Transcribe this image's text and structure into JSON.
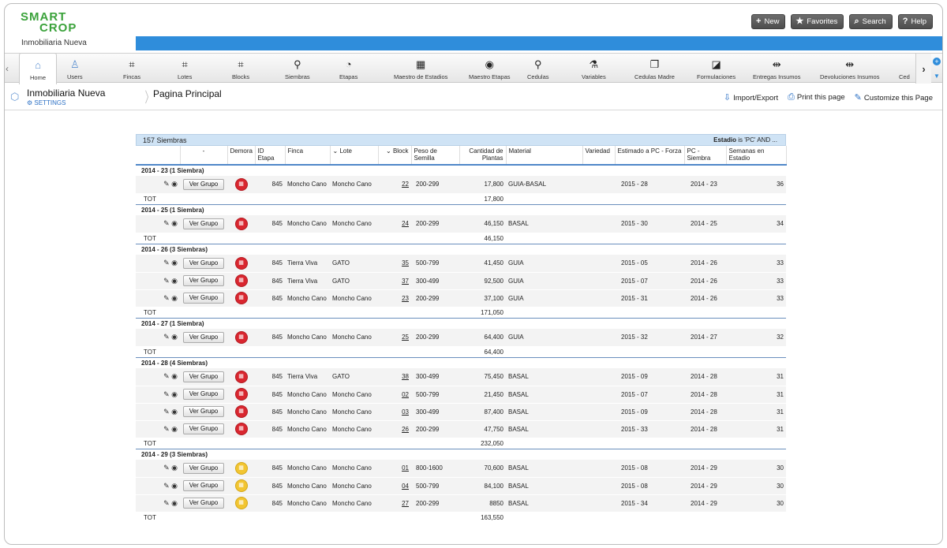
{
  "header": {
    "logo_line1": "SMART",
    "logo_line2": "CROP",
    "org_name": "Inmobiliaria Nueva",
    "buttons": [
      {
        "icon": "plus-icon",
        "glyph": "+",
        "label": "New"
      },
      {
        "icon": "star-icon",
        "glyph": "★",
        "label": "Favorites"
      },
      {
        "icon": "search-icon",
        "glyph": "⌕",
        "label": "Search"
      },
      {
        "icon": "help-icon",
        "glyph": "?",
        "label": "Help"
      }
    ]
  },
  "nav": {
    "items": [
      {
        "label": "Home",
        "icon": "home-icon",
        "glyph": "⌂"
      },
      {
        "label": "Users",
        "icon": "user-icon",
        "glyph": "♙"
      },
      {
        "label": "Fincas",
        "icon": "grid-icon",
        "glyph": "⌗"
      },
      {
        "label": "Lotes",
        "icon": "grid-icon",
        "glyph": "⌗"
      },
      {
        "label": "Blocks",
        "icon": "grid-icon",
        "glyph": "⌗"
      },
      {
        "label": "Siembras",
        "icon": "sprout-icon",
        "glyph": "⚲"
      },
      {
        "label": "Etapas",
        "icon": "clock-icon",
        "glyph": "◔"
      },
      {
        "label": "Maestro de Estadios",
        "icon": "calendar-icon",
        "glyph": "▦"
      },
      {
        "label": "Maestro Etapas",
        "icon": "gauge-icon",
        "glyph": "◉"
      },
      {
        "label": "Cedulas",
        "icon": "sprout-icon",
        "glyph": "⚲"
      },
      {
        "label": "Variables",
        "icon": "flask-icon",
        "glyph": "⚗"
      },
      {
        "label": "Cedulas Madre",
        "icon": "documents-icon",
        "glyph": "❐"
      },
      {
        "label": "Formulaciones",
        "icon": "tray-icon",
        "glyph": "◪"
      },
      {
        "label": "Entregas Insumos",
        "icon": "exchange-icon",
        "glyph": "⇹"
      },
      {
        "label": "Devoluciones Insumos",
        "icon": "exchange-icon",
        "glyph": "⇹"
      },
      {
        "label": "Ced",
        "icon": "",
        "glyph": ""
      }
    ]
  },
  "breadcrumb": {
    "title": "Inmobiliaria Nueva",
    "settings": "SETTINGS",
    "page": "Pagina Principal",
    "actions": [
      {
        "icon": "import-icon",
        "glyph": "⇩",
        "label": "Import/Export"
      },
      {
        "icon": "print-icon",
        "glyph": "⎙",
        "label": "Print this page"
      },
      {
        "icon": "wrench-icon",
        "glyph": "✎",
        "label": "Customize this Page"
      }
    ]
  },
  "table": {
    "count_label": "157 Siembras",
    "filter_field": "Estadio",
    "filter_rest": " is 'PC' AND ...",
    "columns": [
      "",
      "-",
      "Demora",
      "ID Etapa",
      "Finca",
      "Lote",
      "Block",
      "Peso de Semilla",
      "Cantidad de Plantas",
      "Material",
      "Variedad",
      "Estimado a PC - Forza",
      "PC - Siembra",
      "Semanas en Estadio"
    ],
    "button_label": "Ver Grupo",
    "tot_label": "TOT",
    "groups": [
      {
        "title": "2014 - 23  (1 Siembra)",
        "total": "17,800",
        "rows": [
          {
            "status": "red",
            "id": "845",
            "finca": "Moncho Cano",
            "lote": "Moncho Cano",
            "block": "22",
            "peso": "200-299",
            "cantidad": "17,800",
            "material": "GUIA-BASAL",
            "variedad": "",
            "estimado": "2015 - 28",
            "pc": "2014 - 23",
            "semanas": "36"
          }
        ]
      },
      {
        "title": "2014 - 25  (1 Siembra)",
        "total": "46,150",
        "rows": [
          {
            "status": "red",
            "id": "845",
            "finca": "Moncho Cano",
            "lote": "Moncho Cano",
            "block": "24",
            "peso": "200-299",
            "cantidad": "46,150",
            "material": "BASAL",
            "variedad": "",
            "estimado": "2015 - 30",
            "pc": "2014 - 25",
            "semanas": "34"
          }
        ]
      },
      {
        "title": "2014 - 26  (3 Siembras)",
        "total": "171,050",
        "rows": [
          {
            "status": "red",
            "id": "845",
            "finca": "Tierra Viva",
            "lote": "GATO",
            "block": "35",
            "peso": "500-799",
            "cantidad": "41,450",
            "material": "GUIA",
            "variedad": "",
            "estimado": "2015 - 05",
            "pc": "2014 - 26",
            "semanas": "33"
          },
          {
            "status": "red",
            "id": "845",
            "finca": "Tierra Viva",
            "lote": "GATO",
            "block": "37",
            "peso": "300-499",
            "cantidad": "92,500",
            "material": "GUIA",
            "variedad": "",
            "estimado": "2015 - 07",
            "pc": "2014 - 26",
            "semanas": "33"
          },
          {
            "status": "red",
            "id": "845",
            "finca": "Moncho Cano",
            "lote": "Moncho Cano",
            "block": "23",
            "peso": "200-299",
            "cantidad": "37,100",
            "material": "GUIA",
            "variedad": "",
            "estimado": "2015 - 31",
            "pc": "2014 - 26",
            "semanas": "33"
          }
        ]
      },
      {
        "title": "2014 - 27  (1 Siembra)",
        "total": "64,400",
        "rows": [
          {
            "status": "red",
            "id": "845",
            "finca": "Moncho Cano",
            "lote": "Moncho Cano",
            "block": "25",
            "peso": "200-299",
            "cantidad": "64,400",
            "material": "GUIA",
            "variedad": "",
            "estimado": "2015 - 32",
            "pc": "2014 - 27",
            "semanas": "32"
          }
        ]
      },
      {
        "title": "2014 - 28  (4 Siembras)",
        "total": "232,050",
        "rows": [
          {
            "status": "red",
            "id": "845",
            "finca": "Tierra Viva",
            "lote": "GATO",
            "block": "38",
            "peso": "300-499",
            "cantidad": "75,450",
            "material": "BASAL",
            "variedad": "",
            "estimado": "2015 - 09",
            "pc": "2014 - 28",
            "semanas": "31"
          },
          {
            "status": "red",
            "id": "845",
            "finca": "Moncho Cano",
            "lote": "Moncho Cano",
            "block": "02",
            "peso": "500-799",
            "cantidad": "21,450",
            "material": "BASAL",
            "variedad": "",
            "estimado": "2015 - 07",
            "pc": "2014 - 28",
            "semanas": "31"
          },
          {
            "status": "red",
            "id": "845",
            "finca": "Moncho Cano",
            "lote": "Moncho Cano",
            "block": "03",
            "peso": "300-499",
            "cantidad": "87,400",
            "material": "BASAL",
            "variedad": "",
            "estimado": "2015 - 09",
            "pc": "2014 - 28",
            "semanas": "31"
          },
          {
            "status": "red",
            "id": "845",
            "finca": "Moncho Cano",
            "lote": "Moncho Cano",
            "block": "26",
            "peso": "200-299",
            "cantidad": "47,750",
            "material": "BASAL",
            "variedad": "",
            "estimado": "2015 - 33",
            "pc": "2014 - 28",
            "semanas": "31"
          }
        ]
      },
      {
        "title": "2014 - 29  (3 Siembras)",
        "total": "163,550",
        "rows": [
          {
            "status": "yellow",
            "id": "845",
            "finca": "Moncho Cano",
            "lote": "Moncho Cano",
            "block": "01",
            "peso": "800-1600",
            "cantidad": "70,600",
            "material": "BASAL",
            "variedad": "",
            "estimado": "2015 - 08",
            "pc": "2014 - 29",
            "semanas": "30"
          },
          {
            "status": "yellow",
            "id": "845",
            "finca": "Moncho Cano",
            "lote": "Moncho Cano",
            "block": "04",
            "peso": "500-799",
            "cantidad": "84,100",
            "material": "BASAL",
            "variedad": "",
            "estimado": "2015 - 08",
            "pc": "2014 - 29",
            "semanas": "30"
          },
          {
            "status": "yellow",
            "id": "845",
            "finca": "Moncho Cano",
            "lote": "Moncho Cano",
            "block": "27",
            "peso": "200-299",
            "cantidad": "8850",
            "material": "BASAL",
            "variedad": "",
            "estimado": "2015 - 34",
            "pc": "2014 - 29",
            "semanas": "30"
          }
        ]
      }
    ]
  },
  "colors": {
    "brand_green": "#3aa23a",
    "accent_blue": "#2f8ddb",
    "status_red": "#d9262f",
    "status_yellow": "#f2c531"
  }
}
